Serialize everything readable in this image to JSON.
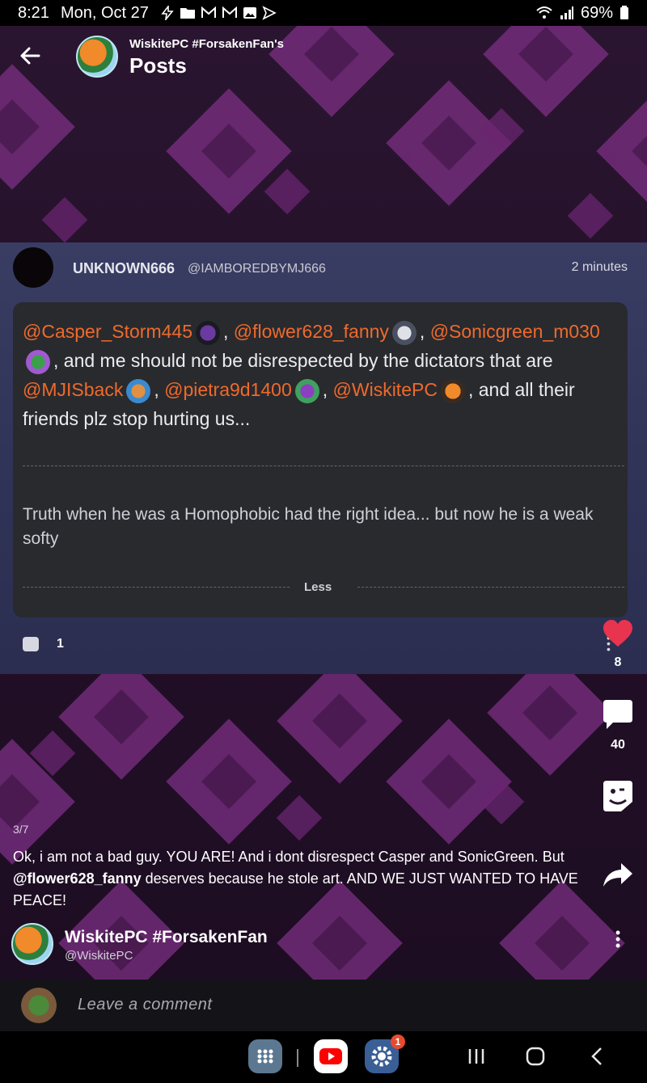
{
  "status": {
    "time": "8:21",
    "date": "Mon, Oct 27",
    "battery": "69%",
    "icons": [
      "flash-icon",
      "folder-icon",
      "gmail-icon",
      "gmail-icon",
      "gallery-icon",
      "send-icon",
      "wifi-icon",
      "signal-icon",
      "battery-icon"
    ]
  },
  "header": {
    "subtitle": "WiskitePC #ForsakenFan's",
    "title": "Posts"
  },
  "embedded_post": {
    "username": "UNKNOWN666",
    "handle": "@IAMBOREDBYMJ666",
    "time": "2 minutes",
    "mentions": {
      "m1": "@Casper_Storm445",
      "m2": "@flower628_fanny",
      "m3": "@Sonicgreen_m030",
      "m4": "@MJISback",
      "m5": "@pietra9d1400",
      "m6": "@WiskitePC"
    },
    "text": {
      "t1": ",",
      "t2": ",",
      "t3": ", and me should not be disrespected by the dictators that are",
      "t4": ",",
      "t5": ",",
      "t6": ", and all their friends plz stop hurting us..."
    },
    "quote": "Truth when he was a Homophobic had the right idea... but now he is a weak softy",
    "less_label": "Less",
    "comment_count": "1"
  },
  "actions": {
    "likes": "8",
    "comments": "40"
  },
  "post": {
    "pager": "3/7",
    "caption_a": "Ok, i am not a bad guy. YOU ARE! And i dont disrespect Casper and SonicGreen. But",
    "caption_mention": "@flower628_fanny",
    "caption_b": "deserves because he stole art. AND WE JUST WANTED TO HAVE PEACE!",
    "author_name": "WiskitePC #ForsakenFan",
    "author_handle": "@WiskitePC"
  },
  "comment_bar": {
    "placeholder": "Leave a comment"
  },
  "nav": {
    "settings_badge": "1"
  },
  "colors": {
    "mention": "#ef6a2b",
    "like": "#e8344e",
    "accent_purple": "#7c2f84"
  }
}
